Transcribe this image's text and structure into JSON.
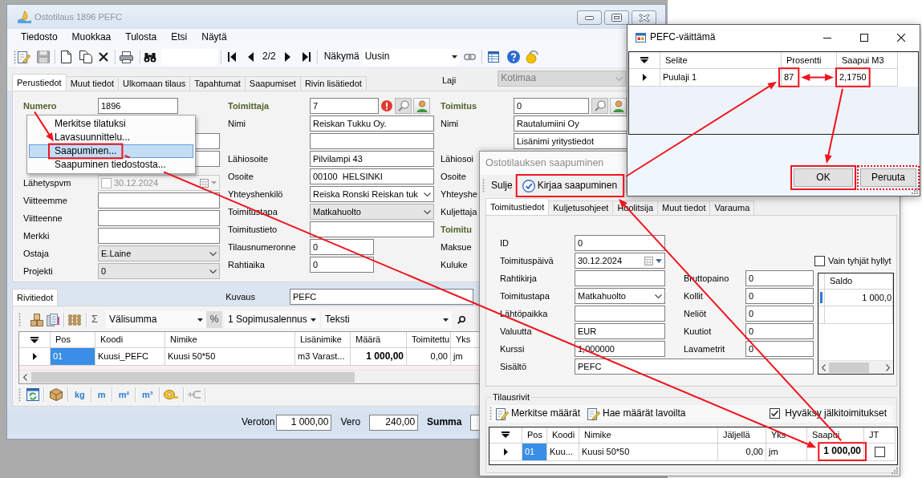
{
  "main_window": {
    "title": "Ostotilaus 1896 PEFC",
    "menu": [
      "Tiedosto",
      "Muokkaa",
      "Tulosta",
      "Etsi",
      "Näytä"
    ],
    "toolbar": {
      "record_counter": "2/2",
      "view_label": "Näkymä",
      "view_value": "Uusin"
    },
    "tabs": [
      {
        "label": "Perustiedot",
        "selected": true
      },
      {
        "label": "Muut tiedot",
        "selected": false
      },
      {
        "label": "Ulkomaan tilaus",
        "selected": false
      },
      {
        "label": "Tapahtumat",
        "selected": false
      },
      {
        "label": "Saapumiset",
        "selected": false
      },
      {
        "label": "Rivin lisätiedot",
        "selected": false
      }
    ],
    "type_field": {
      "label": "Laji",
      "value": "Kotimaa",
      "disabled": true
    },
    "form_columns": [
      [
        {
          "kind": "key",
          "label": "Numero",
          "value": "1896",
          "error": false,
          "lookup": false
        },
        {
          "kind": "text"
        },
        {
          "kind": "text"
        },
        {
          "kind": "date",
          "label": "Lähetyspvm",
          "value": "30.12.2024",
          "checked": false,
          "disabled": true
        },
        {
          "kind": "text",
          "label": "Viitteemme"
        },
        {
          "kind": "text",
          "label": "Viitteenne"
        },
        {
          "kind": "text",
          "label": "Merkki"
        },
        {
          "kind": "list",
          "label": "Ostaja",
          "value": "E.Laine"
        },
        {
          "kind": "list",
          "label": "Projekti",
          "value": "0"
        }
      ],
      [
        {
          "kind": "key",
          "label": "Toimittaja",
          "value": "7",
          "error": true,
          "lookup": true
        },
        {
          "kind": "text",
          "label": "Nimi",
          "value": "Reiskan Tukku Oy."
        },
        {
          "kind": "text"
        },
        {
          "kind": "text",
          "label": "Lähiosoite",
          "value": "Pilvilampi 43"
        },
        {
          "kind": "text",
          "label": "Osoite",
          "value": "00100  HELSINKI"
        },
        {
          "kind": "combo",
          "label": "Yhteyshenkilö",
          "value": "Reiska Ronski Reiskan tuk"
        },
        {
          "kind": "list",
          "label": "Toimitustapa",
          "value": "Matkahuolto"
        },
        {
          "kind": "text",
          "label": "Toimitustieto"
        },
        {
          "kind": "short",
          "label": "Tilausnumeronne",
          "value": "0"
        },
        {
          "kind": "short",
          "label": "Rahtiaika",
          "value": "0"
        }
      ],
      [
        {
          "kind": "key",
          "label": "Toimitus",
          "value": "0",
          "error": false,
          "lookup": true
        },
        {
          "kind": "text",
          "label": "Nimi",
          "value": "Rautalumiini Oy"
        },
        {
          "kind": "text",
          "value": "Lisänimi yritystiedot"
        },
        {
          "kind": "label",
          "label": "Lähiosoi"
        },
        {
          "kind": "label",
          "label": "Osoite"
        },
        {
          "kind": "label",
          "label": "Yhteyshe"
        },
        {
          "kind": "label",
          "label": "Kuljettaja"
        },
        {
          "kind": "heading",
          "label": "Toimitu"
        },
        {
          "kind": "label",
          "label": "Maksue"
        },
        {
          "kind": "label",
          "label": "Kuluke"
        }
      ]
    ],
    "context_menu": {
      "items": [
        {
          "label": "Merkitse tilatuksi",
          "selected": false
        },
        {
          "label": "Lavasuunnittelu...",
          "selected": false
        },
        {
          "label": "Saapuminen...",
          "selected": true
        },
        {
          "label": "Saapuminen tiedostosta...",
          "selected": false
        }
      ]
    },
    "line_items": {
      "tabs": [
        {
          "label": "Rivitiedot",
          "selected": true
        }
      ],
      "description": {
        "label": "Kuvaus",
        "value": "PEFC"
      },
      "toolbar": {
        "sum_symbol": "Σ",
        "subtotal": "Välisumma",
        "percent": "%",
        "discount": "1 Sopimusalennus",
        "text_type": "Teksti"
      },
      "columns": [
        {
          "label": "Pos",
          "kind": "text"
        },
        {
          "label": "Koodi",
          "kind": "text"
        },
        {
          "label": "Nimike",
          "kind": "text"
        },
        {
          "label": "Lisänimike",
          "kind": "text"
        },
        {
          "label": "Määrä",
          "kind": "total"
        },
        {
          "label": "Toimitettu",
          "kind": "number"
        },
        {
          "label": "Yks",
          "kind": "text"
        }
      ],
      "rows": [
        {
          "selected": true,
          "cells": [
            "01",
            "Kuusi_PEFC",
            "Kuusi 50*50",
            "m3 Varast...",
            "1 000,00",
            "0,00",
            "jm"
          ]
        }
      ],
      "unit_buttons": [
        "kg",
        "m",
        "m²",
        "m³"
      ]
    },
    "totals": [
      {
        "kind": "plain",
        "label": "Veroton",
        "value": "1 000,00"
      },
      {
        "kind": "plain",
        "label": "Vero",
        "value": "240,00"
      },
      {
        "kind": "total",
        "label": "Summa"
      }
    ]
  },
  "arrival_dialog": {
    "title": "Ostotilauksen saapuminen",
    "toolbar": [
      {
        "kind": "text",
        "label": "Sulje"
      },
      {
        "kind": "confirm",
        "label": "Kirjaa saapuminen"
      }
    ],
    "tabs": [
      {
        "label": "Toimitustiedot",
        "selected": true
      },
      {
        "label": "Kuljetusohjeet",
        "selected": false
      },
      {
        "label": "Huolitsija",
        "selected": false
      },
      {
        "label": "Muut tiedot",
        "selected": false
      },
      {
        "label": "Varauma",
        "selected": false
      }
    ],
    "fields": [
      {
        "kind": "text",
        "label": "ID",
        "value": "0"
      },
      {
        "kind": "date",
        "label": "Toimituspäivä",
        "value": "30.12.2024"
      },
      {
        "kind": "text",
        "label": "Rahtikirja"
      },
      {
        "kind": "combo",
        "label": "Toimitustapa",
        "value": "Matkahuolto"
      },
      {
        "kind": "text",
        "label": "Lähtöpaikka"
      },
      {
        "kind": "text",
        "label": "Valuutta",
        "value": "EUR"
      },
      {
        "kind": "text",
        "label": "Kurssi",
        "value": "1,000000"
      },
      {
        "kind": "wide",
        "label": "Sisältö",
        "value": "PEFC"
      }
    ],
    "measures": [
      {
        "label": "Bruttopaino",
        "value": "0"
      },
      {
        "label": "Kollit",
        "value": "0"
      },
      {
        "label": "Neliöt",
        "value": "0"
      },
      {
        "label": "Kuutiot",
        "value": "0"
      },
      {
        "label": "Lavametrit",
        "value": "0"
      }
    ],
    "empty_shelves_only": {
      "label": "Vain tyhjät hyllyt",
      "checked": false
    },
    "stock_grid": {
      "column": "Saldo",
      "rows": [
        {
          "selected": true,
          "value": "1 000,0"
        }
      ]
    },
    "order_lines": {
      "title": "Tilausrivit",
      "actions": [
        "Merkitse määrät",
        "Hae määrät lavoilta"
      ],
      "accept_backorders": {
        "label": "Hyväksy jälkitoimitukset",
        "checked": true
      },
      "columns": [
        {
          "label": "Pos",
          "kind": "text"
        },
        {
          "label": "Koodi",
          "kind": "text"
        },
        {
          "label": "Nimike",
          "kind": "text"
        },
        {
          "label": "Jäljellä",
          "kind": "number"
        },
        {
          "label": "Yks",
          "kind": "text"
        },
        {
          "label": "Saapui",
          "kind": "total"
        },
        {
          "label": "JT",
          "kind": "check"
        }
      ],
      "rows": [
        {
          "selected": true,
          "cells": [
            "01",
            "Kuu...",
            "Kuusi 50*50",
            "0,00",
            "jm",
            "1 000,00"
          ],
          "jt_checked": false
        }
      ]
    }
  },
  "pefc_dialog": {
    "title": "PEFC-väittämä",
    "columns": [
      "Selite",
      "Prosentti",
      "Saapui M3"
    ],
    "rows": [
      {
        "selected": true,
        "cells": [
          "Puulaji 1",
          "87",
          "2,1750"
        ]
      }
    ],
    "buttons": [
      "OK",
      "Peruuta"
    ]
  }
}
